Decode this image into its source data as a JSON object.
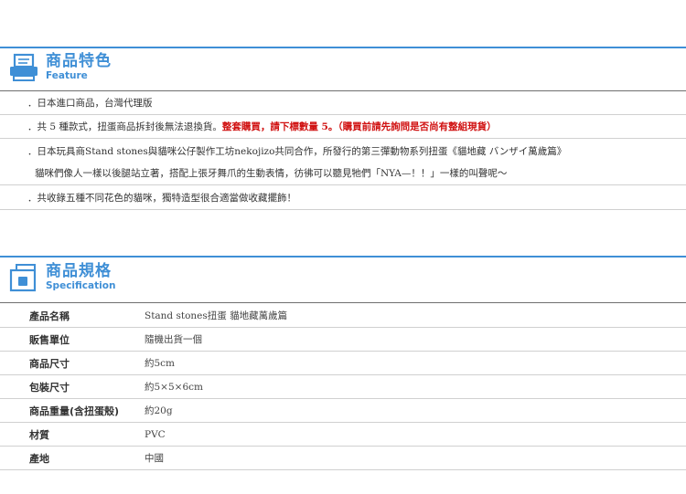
{
  "feature": {
    "title_zh": "商品特色",
    "title_en": "Feature",
    "items": [
      {
        "prefix": "．日本進口商品，台灣代理版"
      },
      {
        "prefix": "．共 5 種款式，扭蛋商品拆封後無法退換貨。",
        "highlight": "整套購買，請下標數量 5。（購買前請先詢問是否尚有整組現貨）"
      },
      {
        "prefix": "．日本玩具商Stand stones與貓咪公仔製作工坊nekojizo共同合作，所發行的第三彈動物系列扭蛋《貓地藏 バンザイ萬歲篇》"
      },
      {
        "prefix": "貓咪們像人一樣以後腿站立著，搭配上張牙舞爪的生動表情，彷彿可以聽見牠們「NYA—！！」一樣的叫聲呢～"
      },
      {
        "prefix": "．共收錄五種不同花色的貓咪，獨特造型很合適當做收藏擺飾！"
      }
    ]
  },
  "spec": {
    "title_zh": "商品規格",
    "title_en": "Specification",
    "rows": [
      {
        "key": "產品名稱",
        "value": "Stand stones扭蛋 貓地藏萬歲篇"
      },
      {
        "key": "販售單位",
        "value": "隨機出貨一個"
      },
      {
        "key": "商品尺寸",
        "value": "約5cm"
      },
      {
        "key": "包裝尺寸",
        "value": "約5×5×6cm"
      },
      {
        "key": "商品重量(含扭蛋殼)",
        "value": "約20g"
      },
      {
        "key": "材質",
        "value": "PVC"
      },
      {
        "key": "產地",
        "value": "中國"
      }
    ]
  },
  "colors": {
    "accent": "#3f8fd6",
    "highlight": "#d01010"
  },
  "icons": {
    "feature": "printer-icon",
    "spec": "box-icon"
  }
}
